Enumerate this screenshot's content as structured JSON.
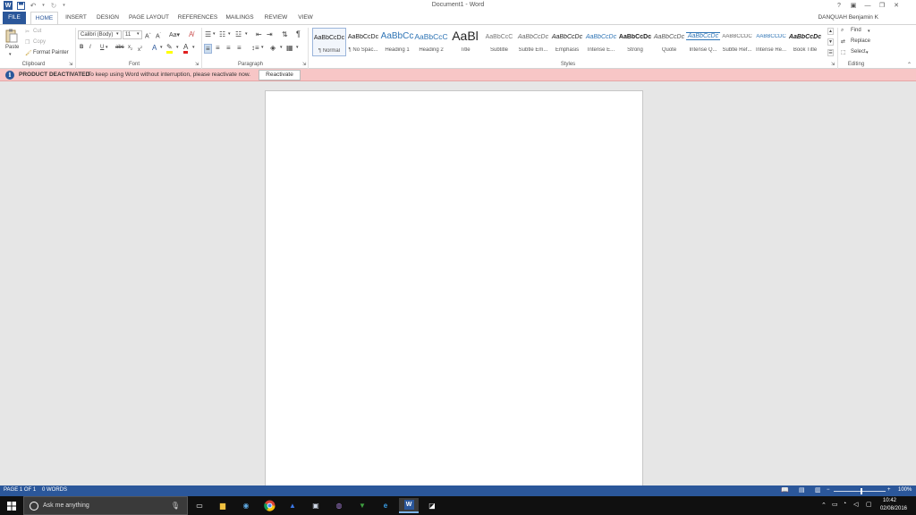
{
  "titlebar": {
    "title": "Document1 - Word",
    "user": "DANQUAH Benjamin K"
  },
  "tabs": [
    "FILE",
    "HOME",
    "INSERT",
    "DESIGN",
    "PAGE LAYOUT",
    "REFERENCES",
    "MAILINGS",
    "REVIEW",
    "VIEW"
  ],
  "ribbon": {
    "clipboard": {
      "label": "Clipboard",
      "paste": "Paste",
      "cut": "Cut",
      "copy": "Copy",
      "format_painter": "Format Painter"
    },
    "font": {
      "label": "Font",
      "font_name": "Calibri (Body)",
      "font_size": "11"
    },
    "paragraph": {
      "label": "Paragraph"
    },
    "styles": {
      "label": "Styles",
      "items": [
        {
          "sample": "AaBbCcDc",
          "name": "¶ Normal"
        },
        {
          "sample": "AaBbCcDc",
          "name": "¶ No Spac..."
        },
        {
          "sample": "AaBbCc",
          "name": "Heading 1"
        },
        {
          "sample": "AaBbCcC",
          "name": "Heading 2"
        },
        {
          "sample": "AaBl",
          "name": "Title"
        },
        {
          "sample": "AaBbCcC",
          "name": "Subtitle"
        },
        {
          "sample": "AaBbCcDc",
          "name": "Subtle Em..."
        },
        {
          "sample": "AaBbCcDc",
          "name": "Emphasis"
        },
        {
          "sample": "AaBbCcDc",
          "name": "Intense E..."
        },
        {
          "sample": "AaBbCcDc",
          "name": "Strong"
        },
        {
          "sample": "AaBbCcDc",
          "name": "Quote"
        },
        {
          "sample": "AaBbCcDc",
          "name": "Intense Q..."
        },
        {
          "sample": "AABBCCDC",
          "name": "Subtle Ref..."
        },
        {
          "sample": "AABBCCDC",
          "name": "Intense Re..."
        },
        {
          "sample": "AaBbCcDc",
          "name": "Book Title"
        }
      ]
    },
    "editing": {
      "label": "Editing",
      "find": "Find",
      "replace": "Replace",
      "select": "Select"
    }
  },
  "message_bar": {
    "title": "PRODUCT DEACTIVATED",
    "text": "To keep using Word without interruption, please reactivate now.",
    "button": "Reactivate"
  },
  "statusbar": {
    "page": "PAGE 1 OF 1",
    "words": "0 WORDS",
    "zoom": "100%"
  },
  "taskbar": {
    "search_placeholder": "Ask me anything",
    "time": "10:42",
    "date": "02/08/2016"
  },
  "colors": {
    "word_blue": "#2b579a",
    "message_bar": "#f7c6c6",
    "page_background": "#e6e6e6"
  }
}
